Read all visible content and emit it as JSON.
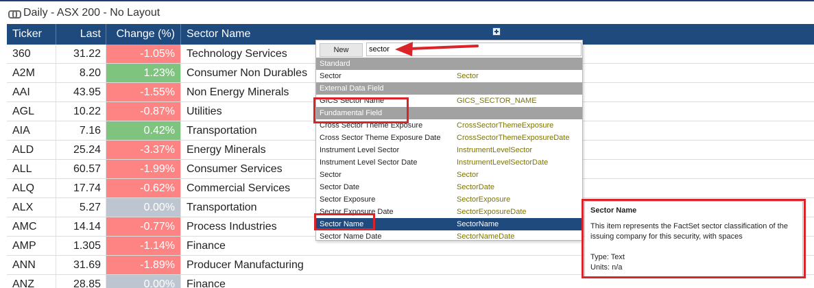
{
  "title": {
    "text": "Daily - ASX 200 - No Layout",
    "icon": "link-icon"
  },
  "grid": {
    "headers": {
      "ticker": "Ticker",
      "last": "Last",
      "change": "Change (%)",
      "sector": "Sector Name"
    },
    "rows": [
      {
        "ticker": "360",
        "last": "31.22",
        "change": "-1.05%",
        "sector": "Technology Services",
        "color": "#fe8484"
      },
      {
        "ticker": "A2M",
        "last": "8.20",
        "change": "1.23%",
        "sector": "Consumer Non Durables",
        "color": "#7ec47f"
      },
      {
        "ticker": "AAI",
        "last": "43.95",
        "change": "-1.55%",
        "sector": "Non Energy Minerals",
        "color": "#fe8484"
      },
      {
        "ticker": "AGL",
        "last": "10.22",
        "change": "-0.87%",
        "sector": "Utilities",
        "color": "#fe8484"
      },
      {
        "ticker": "AIA",
        "last": "7.16",
        "change": "0.42%",
        "sector": "Transportation",
        "color": "#7ec47f"
      },
      {
        "ticker": "ALD",
        "last": "25.24",
        "change": "-3.37%",
        "sector": "Energy Minerals",
        "color": "#fe8484"
      },
      {
        "ticker": "ALL",
        "last": "60.57",
        "change": "-1.99%",
        "sector": "Consumer Services",
        "color": "#fe8484"
      },
      {
        "ticker": "ALQ",
        "last": "17.74",
        "change": "-0.62%",
        "sector": "Commercial Services",
        "color": "#fe8484"
      },
      {
        "ticker": "ALX",
        "last": "5.27",
        "change": "0.00%",
        "sector": "Transportation",
        "color": "#bcc5d0"
      },
      {
        "ticker": "AMC",
        "last": "14.14",
        "change": "-0.77%",
        "sector": "Process Industries",
        "color": "#fe8484"
      },
      {
        "ticker": "AMP",
        "last": "1.305",
        "change": "-1.14%",
        "sector": "Finance",
        "color": "#fe8484"
      },
      {
        "ticker": "ANN",
        "last": "31.69",
        "change": "-1.89%",
        "sector": "Producer Manufacturing",
        "color": "#fe8484"
      },
      {
        "ticker": "ANZ",
        "last": "28.85",
        "change": "0.00%",
        "sector": "Finance",
        "color": "#bcc5d0"
      }
    ]
  },
  "popup": {
    "new_label": "New",
    "search_value": "sector",
    "items": [
      {
        "kind": "section",
        "name": "Standard"
      },
      {
        "kind": "item",
        "name": "Sector",
        "code": "Sector"
      },
      {
        "kind": "section",
        "name": "External Data Field"
      },
      {
        "kind": "item",
        "name": "GICS Sector Name",
        "code": "GICS_SECTOR_NAME"
      },
      {
        "kind": "section",
        "name": "Fundamental Field"
      },
      {
        "kind": "item",
        "name": "Cross Sector Theme Exposure",
        "code": "CrossSectorThemeExposure"
      },
      {
        "kind": "item",
        "name": "Cross Sector Theme Exposure Date",
        "code": "CrossSectorThemeExposureDate"
      },
      {
        "kind": "item",
        "name": "Instrument Level Sector",
        "code": "InstrumentLevelSector"
      },
      {
        "kind": "item",
        "name": "Instrument Level Sector Date",
        "code": "InstrumentLevelSectorDate"
      },
      {
        "kind": "item",
        "name": "Sector",
        "code": "Sector"
      },
      {
        "kind": "item",
        "name": "Sector Date",
        "code": "SectorDate"
      },
      {
        "kind": "item",
        "name": "Sector Exposure",
        "code": "SectorExposure"
      },
      {
        "kind": "item",
        "name": "Sector Exposure Date",
        "code": "SectorExposureDate"
      },
      {
        "kind": "item",
        "name": "Sector Name",
        "code": "SectorName",
        "selected": true
      },
      {
        "kind": "item",
        "name": "Sector Name Date",
        "code": "SectorNameDate"
      }
    ]
  },
  "tooltip": {
    "title": "Sector Name",
    "description": "This item represents the FactSet sector classification of the issuing company for this security, with spaces",
    "type": "Type: Text",
    "units": "Units: n/a"
  },
  "annotations": {
    "color": "#d9252a"
  }
}
